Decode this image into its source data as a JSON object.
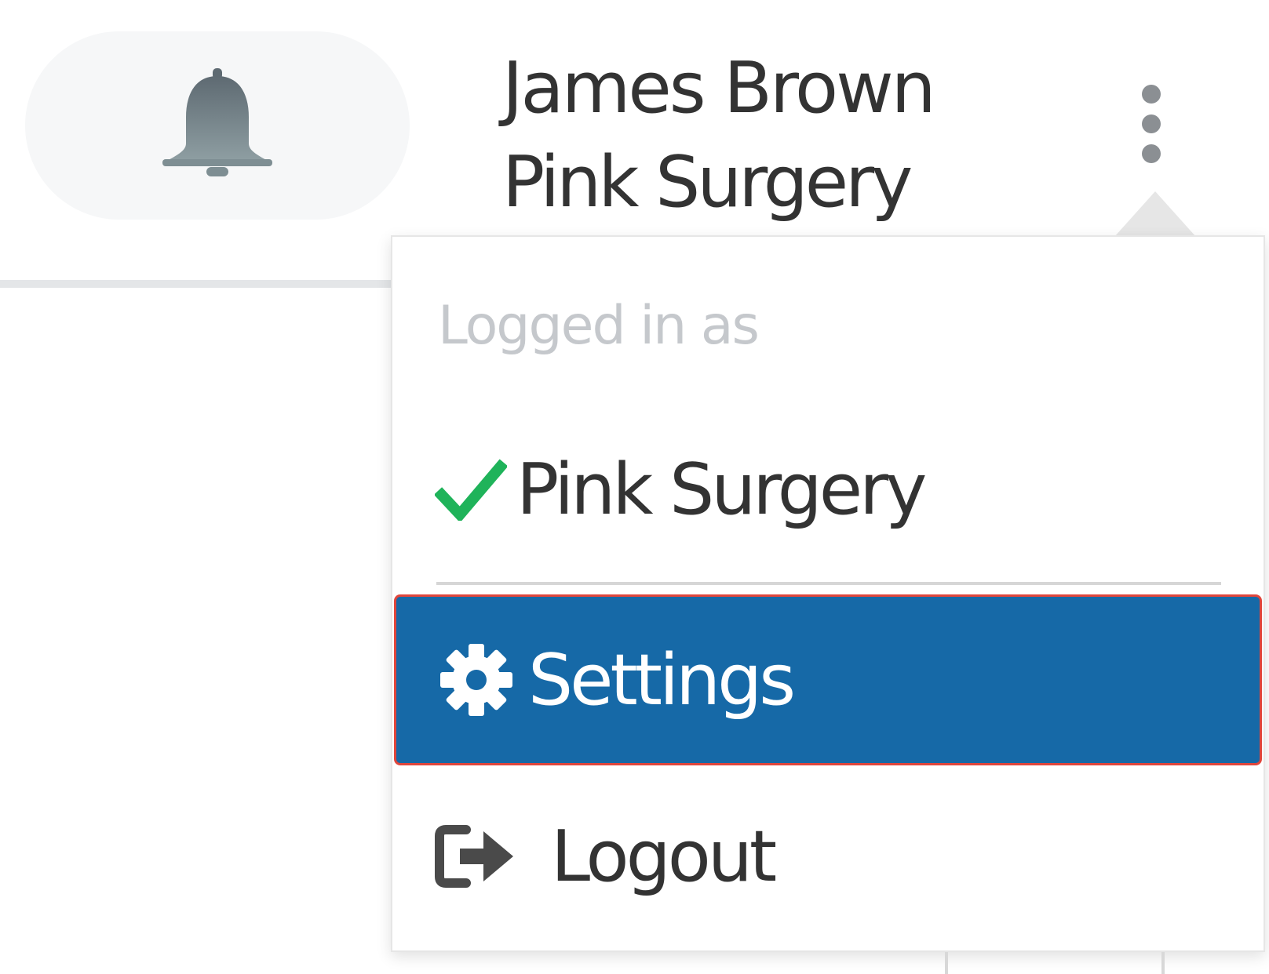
{
  "header": {
    "notifications_icon": "bell-icon",
    "user": {
      "name": "James Brown",
      "practice": "Pink Surgery"
    },
    "menu_icon": "kebab-vertical-icon"
  },
  "user_menu": {
    "heading": "Logged in as",
    "current_practice": {
      "label": "Pink Surgery",
      "icon": "check-icon",
      "icon_color": "#1fb35a"
    },
    "settings": {
      "label": "Settings",
      "icon": "gear-icon",
      "state": "highlighted",
      "background_color": "#1669a7",
      "outline_color": "#e0463c"
    },
    "logout": {
      "label": "Logout",
      "icon": "sign-out-icon"
    }
  }
}
